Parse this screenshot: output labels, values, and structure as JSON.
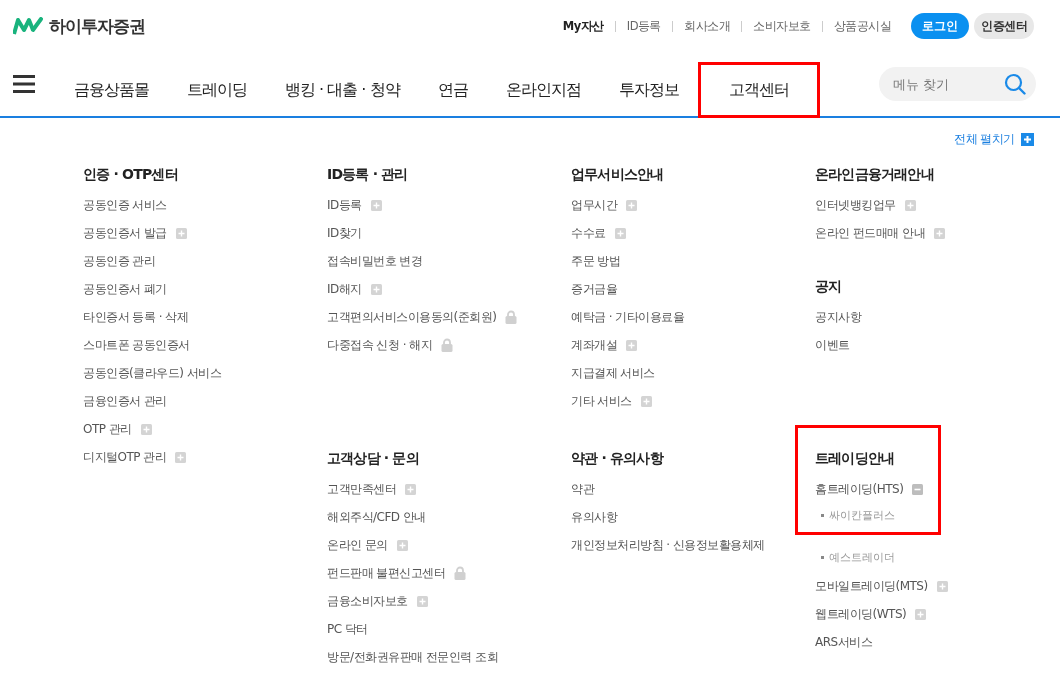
{
  "brand": {
    "name": "하이투자증권"
  },
  "util_links": [
    {
      "label": "My자산",
      "bold": true
    },
    {
      "label": "ID등록",
      "bold": false
    },
    {
      "label": "회사소개",
      "bold": false
    },
    {
      "label": "소비자보호",
      "bold": false
    },
    {
      "label": "상품공시실",
      "bold": false
    }
  ],
  "login_button": "로그인",
  "cert_button": "인증센터",
  "nav": [
    {
      "label": "금융상품몰",
      "selected": false
    },
    {
      "label": "트레이딩",
      "selected": false
    },
    {
      "label": "뱅킹 · 대출 · 청약",
      "selected": false
    },
    {
      "label": "연금",
      "selected": false
    },
    {
      "label": "온라인지점",
      "selected": false
    },
    {
      "label": "투자정보",
      "selected": false
    },
    {
      "label": "고객센터",
      "selected": true
    }
  ],
  "search": {
    "placeholder": "메뉴 찾기"
  },
  "expand_all": "전체 펼치기",
  "columns": [
    {
      "groups": [
        [
          {
            "title": "인증 · OTP센터",
            "highlighted": false,
            "items": [
              {
                "label": "공동인증 서비스",
                "kind": "plain"
              },
              {
                "label": "공동인증서 발급",
                "kind": "expandable"
              },
              {
                "label": "공동인증 관리",
                "kind": "plain"
              },
              {
                "label": "공동인증서 폐기",
                "kind": "plain"
              },
              {
                "label": "타인증서 등록 · 삭제",
                "kind": "plain"
              },
              {
                "label": "스마트폰 공동인증서",
                "kind": "plain"
              },
              {
                "label": "공동인증(클라우드) 서비스",
                "kind": "plain"
              },
              {
                "label": "금융인증서 관리",
                "kind": "plain"
              },
              {
                "label": "OTP 관리",
                "kind": "expandable"
              },
              {
                "label": "디지털OTP 관리",
                "kind": "expandable"
              }
            ]
          }
        ]
      ]
    },
    {
      "groups": [
        [
          {
            "title": "ID등록 · 관리",
            "highlighted": false,
            "items": [
              {
                "label": "ID등록",
                "kind": "expandable"
              },
              {
                "label": "ID찾기",
                "kind": "plain"
              },
              {
                "label": "접속비밀번호 변경",
                "kind": "plain"
              },
              {
                "label": "ID해지",
                "kind": "expandable"
              },
              {
                "label": "고객편의서비스이용동의(준회원)",
                "kind": "locked"
              },
              {
                "label": "다중접속 신청 · 해지",
                "kind": "locked"
              }
            ]
          }
        ],
        [
          {
            "title": "고객상담 · 문의",
            "highlighted": false,
            "items": [
              {
                "label": "고객만족센터",
                "kind": "expandable"
              },
              {
                "label": "해외주식/CFD 안내",
                "kind": "plain"
              },
              {
                "label": "온라인 문의",
                "kind": "expandable"
              },
              {
                "label": "펀드판매 불편신고센터",
                "kind": "locked"
              },
              {
                "label": "금융소비자보호",
                "kind": "expandable"
              },
              {
                "label": "PC 닥터",
                "kind": "plain"
              },
              {
                "label": "방문/전화권유판매 전문인력 조회",
                "kind": "plain"
              }
            ]
          }
        ]
      ]
    },
    {
      "groups": [
        [
          {
            "title": "업무서비스안내",
            "highlighted": false,
            "items": [
              {
                "label": "업무시간",
                "kind": "expandable"
              },
              {
                "label": "수수료",
                "kind": "expandable"
              },
              {
                "label": "주문 방법",
                "kind": "plain"
              },
              {
                "label": "증거금율",
                "kind": "plain"
              },
              {
                "label": "예탁금 · 기타이용료율",
                "kind": "plain"
              },
              {
                "label": "계좌개설",
                "kind": "expandable"
              },
              {
                "label": "지급결제 서비스",
                "kind": "plain"
              },
              {
                "label": "기타 서비스",
                "kind": "expandable"
              }
            ]
          }
        ],
        [
          {
            "title": "약관 · 유의사항",
            "highlighted": false,
            "items": [
              {
                "label": "약관",
                "kind": "plain"
              },
              {
                "label": "유의사항",
                "kind": "plain"
              },
              {
                "label": "개인정보처리방침 · 신용정보활용체제",
                "kind": "plain"
              }
            ]
          }
        ]
      ]
    },
    {
      "groups": [
        [
          {
            "title": "온라인금융거래안내",
            "highlighted": false,
            "items": [
              {
                "label": "인터넷뱅킹업무",
                "kind": "expandable"
              },
              {
                "label": "온라인 펀드매매 안내",
                "kind": "expandable"
              }
            ]
          },
          {
            "title": "공지",
            "highlighted": false,
            "items": [
              {
                "label": "공지사항",
                "kind": "plain"
              },
              {
                "label": "이벤트",
                "kind": "plain"
              }
            ]
          }
        ],
        [
          {
            "title": "트레이딩안내",
            "highlighted": true,
            "items": [
              {
                "label": "홈트레이딩(HTS)",
                "kind": "expanded",
                "children": [
                  "싸이칸플러스",
                  "예스트레이더"
                ]
              },
              {
                "label": "모바일트레이딩(MTS)",
                "kind": "expandable"
              },
              {
                "label": "웹트레이딩(WTS)",
                "kind": "expandable"
              },
              {
                "label": "ARS서비스",
                "kind": "plain"
              }
            ]
          }
        ]
      ]
    }
  ]
}
